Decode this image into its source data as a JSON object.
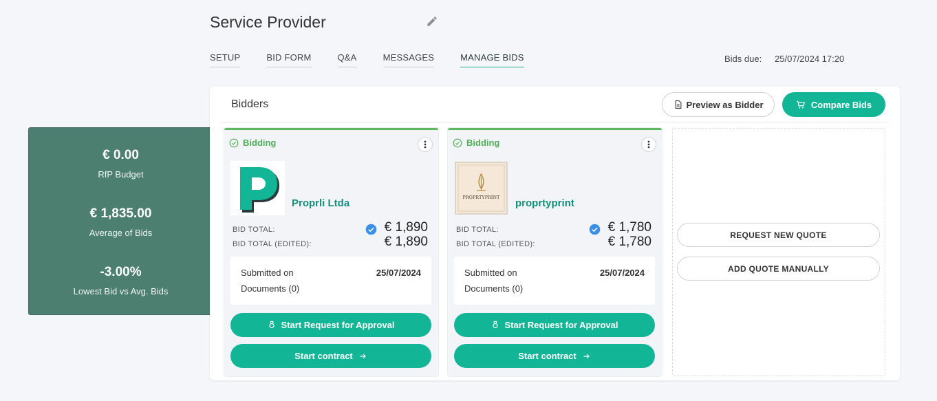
{
  "header": {
    "title": "Service Provider"
  },
  "tabs": [
    {
      "label": "SETUP"
    },
    {
      "label": "BID FORM"
    },
    {
      "label": "Q&A"
    },
    {
      "label": "MESSAGES"
    },
    {
      "label": "MANAGE BIDS",
      "active": true
    }
  ],
  "bids_due": {
    "label": "Bids due:",
    "value": "25/07/2024 17:20"
  },
  "summary": {
    "budget_value": "€ 0.00",
    "budget_label": "RfP Budget",
    "average_value": "€ 1,835.00",
    "average_label": "Average of Bids",
    "lowest_value": "-3.00%",
    "lowest_label": "Lowest Bid vs Avg. Bids"
  },
  "panel": {
    "title": "Bidders",
    "preview_label": "Preview as Bidder",
    "compare_label": "Compare Bids"
  },
  "bidders": [
    {
      "status": "Bidding",
      "name": "Proprli Ltda",
      "logo_letter": "P",
      "bid_total_label": "BID TOTAL:",
      "bid_total": "€ 1,890",
      "bid_total_edited_label": "BID TOTAL (EDITED):",
      "bid_total_edited": "€ 1,890",
      "submitted_label": "Submitted on",
      "submitted_date": "25/07/2024",
      "documents": "Documents (0)",
      "approval_label": "Start Request for Approval",
      "contract_label": "Start contract"
    },
    {
      "status": "Bidding",
      "name": "proprtyprint",
      "logo_text": "PROPRTYPRINT",
      "bid_total_label": "BID TOTAL:",
      "bid_total": "€ 1,780",
      "bid_total_edited_label": "BID TOTAL (EDITED):",
      "bid_total_edited": "€ 1,780",
      "submitted_label": "Submitted on",
      "submitted_date": "25/07/2024",
      "documents": "Documents (0)",
      "approval_label": "Start Request for Approval",
      "contract_label": "Start contract"
    }
  ],
  "empty_slot": {
    "request_label": "REQUEST NEW QUOTE",
    "manual_label": "ADD QUOTE MANUALLY"
  },
  "colors": {
    "accent": "#13b597",
    "summary_bg": "#4c7f6f",
    "status_green": "#4fae57",
    "verified_blue": "#3b8fe8"
  },
  "icons": {
    "edit": "pencil-icon",
    "status": "check-circle-icon",
    "menu": "kebab-icon",
    "verified": "verified-check-icon",
    "preview": "document-icon",
    "compare": "cart-icon",
    "approval": "award-icon",
    "contract": "arrow-right-icon"
  }
}
